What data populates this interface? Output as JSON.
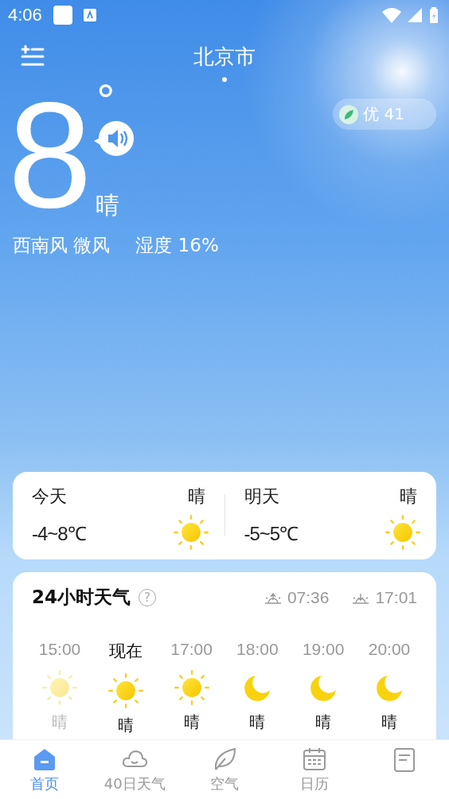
{
  "status_bar": {
    "time": "4:06"
  },
  "header": {
    "city": "北京市"
  },
  "now": {
    "temperature": "8",
    "unit": "°",
    "condition": "晴",
    "wind": "西南风 微风",
    "humidity": "湿度 16%",
    "air_quality": "优 41"
  },
  "days": [
    {
      "label": "今天",
      "condition": "晴",
      "range": "-4~8℃",
      "kind": "sun"
    },
    {
      "label": "明天",
      "condition": "晴",
      "range": "-5~5℃",
      "kind": "sun"
    }
  ],
  "hourly": {
    "title": "24小时天气",
    "help": "?",
    "sunrise": "07:36",
    "sunset": "17:01",
    "hours": [
      {
        "time": "15:00",
        "kind": "sun",
        "condition": "晴",
        "past": true,
        "current": false
      },
      {
        "time": "现在",
        "kind": "sun",
        "condition": "晴",
        "past": false,
        "current": true
      },
      {
        "time": "17:00",
        "kind": "sun",
        "condition": "晴",
        "past": false,
        "current": false
      },
      {
        "time": "18:00",
        "kind": "moon",
        "condition": "晴",
        "past": false,
        "current": false
      },
      {
        "time": "19:00",
        "kind": "moon",
        "condition": "晴",
        "past": false,
        "current": false
      },
      {
        "time": "20:00",
        "kind": "moon",
        "condition": "晴",
        "past": false,
        "current": false
      }
    ]
  },
  "tabs": [
    {
      "label": "首页",
      "kind": "home",
      "selected": true
    },
    {
      "label": "40日天气",
      "kind": "cloud",
      "selected": false
    },
    {
      "label": "空气",
      "kind": "leaf",
      "selected": false
    },
    {
      "label": "日历",
      "kind": "calendar",
      "selected": false
    },
    {
      "kind": "note",
      "selected": false
    }
  ]
}
